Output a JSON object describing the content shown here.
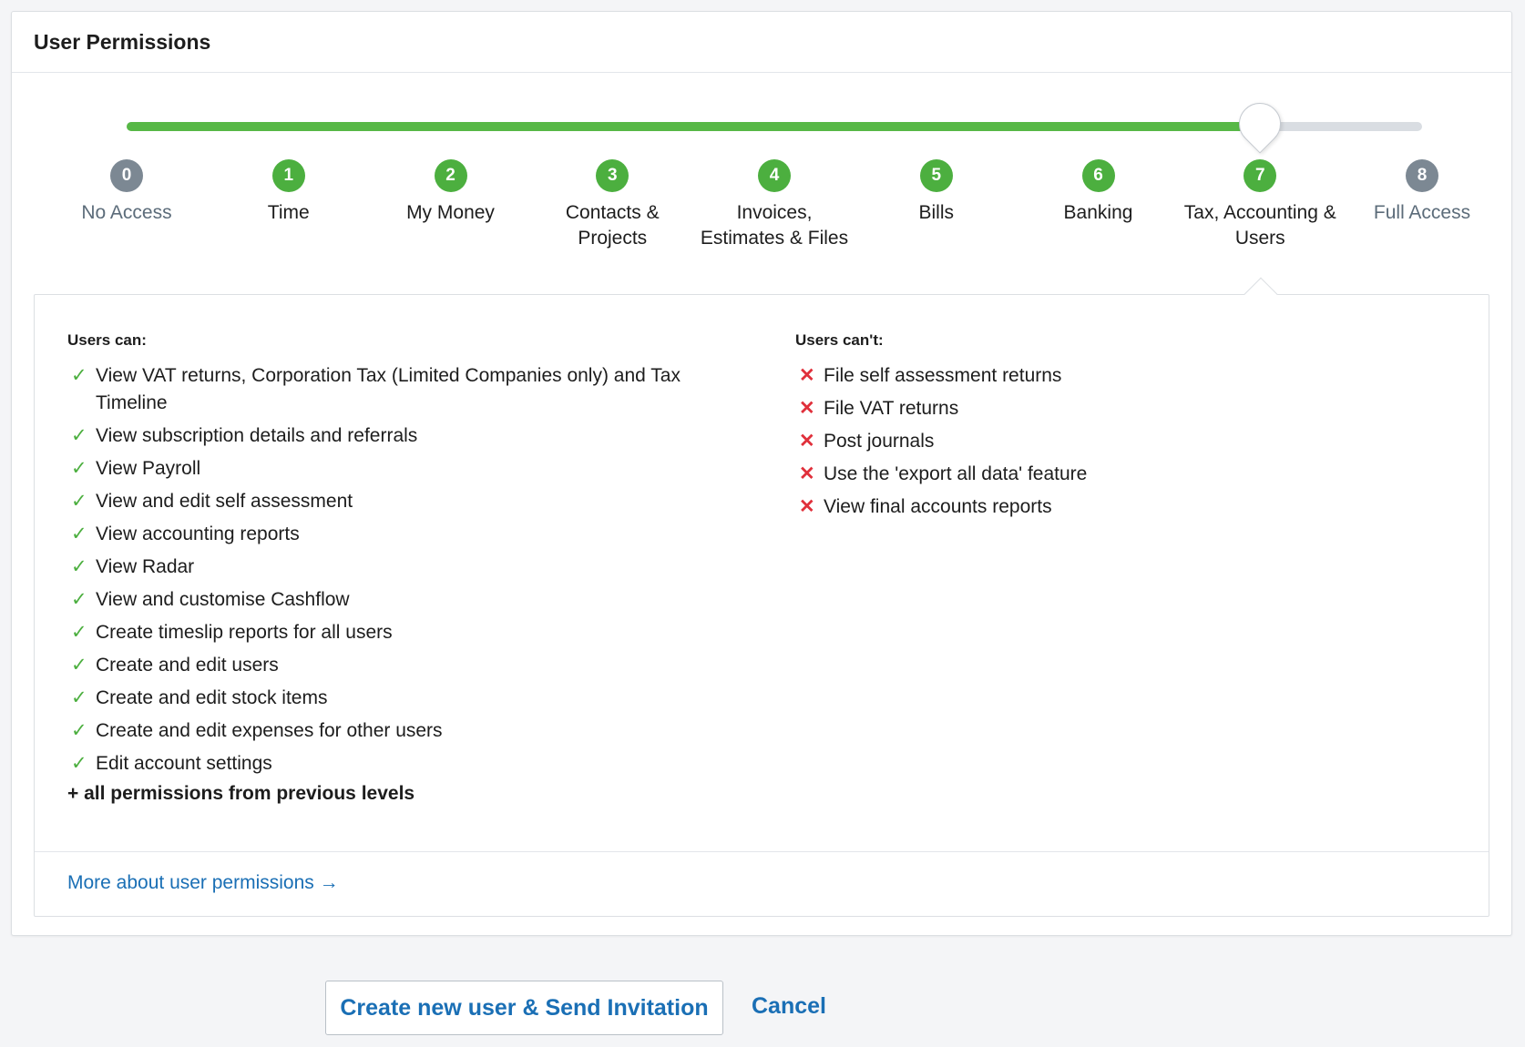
{
  "panel": {
    "title": "User Permissions"
  },
  "slider": {
    "selected_level": 7,
    "levels": [
      {
        "number": "0",
        "label": "No Access",
        "status": "grey"
      },
      {
        "number": "1",
        "label": "Time",
        "status": "green"
      },
      {
        "number": "2",
        "label": "My Money",
        "status": "green"
      },
      {
        "number": "3",
        "label": "Contacts & Projects",
        "status": "green"
      },
      {
        "number": "4",
        "label": "Invoices, Estimates & Files",
        "status": "green"
      },
      {
        "number": "5",
        "label": "Bills",
        "status": "green"
      },
      {
        "number": "6",
        "label": "Banking",
        "status": "green"
      },
      {
        "number": "7",
        "label": "Tax, Accounting & Users",
        "status": "green"
      },
      {
        "number": "8",
        "label": "Full Access",
        "status": "grey"
      }
    ]
  },
  "details": {
    "can_heading": "Users can:",
    "can_items": [
      "View VAT returns, Corporation Tax (Limited Companies only) and Tax Timeline",
      "View subscription details and referrals",
      "View Payroll",
      "View and edit self assessment",
      "View accounting reports",
      "View Radar",
      "View and customise Cashflow",
      "Create timeslip reports for all users",
      "Create and edit users",
      "Create and edit stock items",
      "Create and edit expenses for other users",
      "Edit account settings"
    ],
    "can_extra": "+ all permissions from previous levels",
    "cant_heading": "Users can't:",
    "cant_items": [
      "File self assessment returns",
      "File VAT returns",
      "Post journals",
      "Use the 'export all data' feature",
      "View final accounts reports"
    ],
    "more_link": "More about user permissions →"
  },
  "icons": {
    "check": "check-icon",
    "cross": "cross-icon"
  },
  "colors": {
    "green": "#4caf3f",
    "grey": "#7c8893",
    "link": "#1a6fb5",
    "cross": "#e0303b"
  },
  "actions": {
    "create_label": "Create new user & Send Invitation",
    "cancel_label": "Cancel"
  }
}
